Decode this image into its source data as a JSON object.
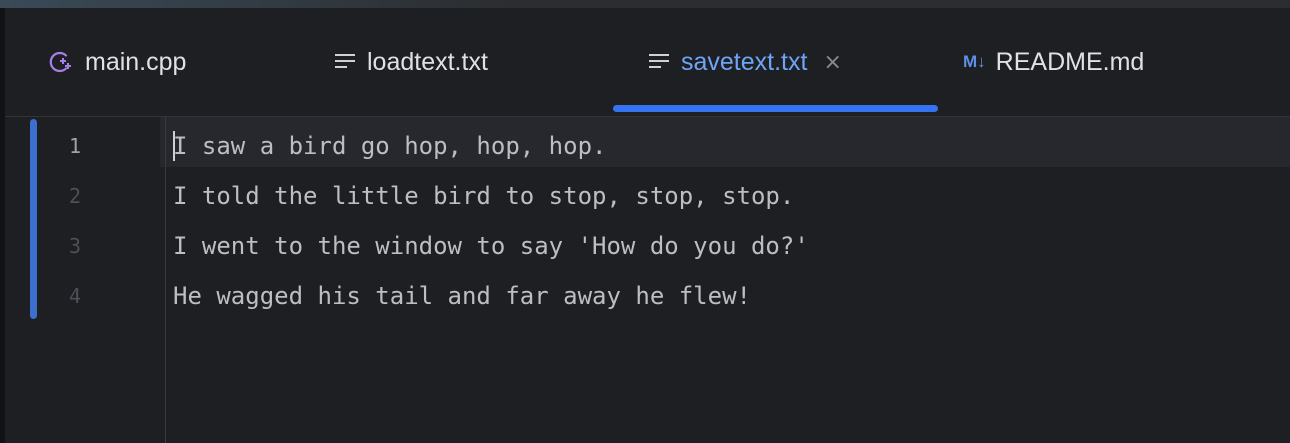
{
  "tabs": [
    {
      "label": "main.cpp",
      "icon": "cpp-file-icon",
      "active": false
    },
    {
      "label": "loadtext.txt",
      "icon": "text-file-icon",
      "active": false
    },
    {
      "label": "savetext.txt",
      "icon": "text-file-icon",
      "active": true,
      "close": "×"
    },
    {
      "label": "README.md",
      "icon": "markdown-file-icon",
      "badge": "M↓",
      "active": false
    }
  ],
  "editor": {
    "current_line": 1,
    "lines": [
      {
        "number": "1",
        "text": "I saw a bird go hop, hop, hop."
      },
      {
        "number": "2",
        "text": "I told the little bird to stop, stop, stop."
      },
      {
        "number": "3",
        "text": "I went to the window to say 'How do you do?'"
      },
      {
        "number": "4",
        "text": "He wagged his tail and far away he flew!"
      }
    ]
  },
  "colors": {
    "background": "#1e1f22",
    "accent": "#3574f0",
    "active_tab_text": "#6ea5f7",
    "text": "#bcbec4",
    "line_number": "#4b5059"
  }
}
